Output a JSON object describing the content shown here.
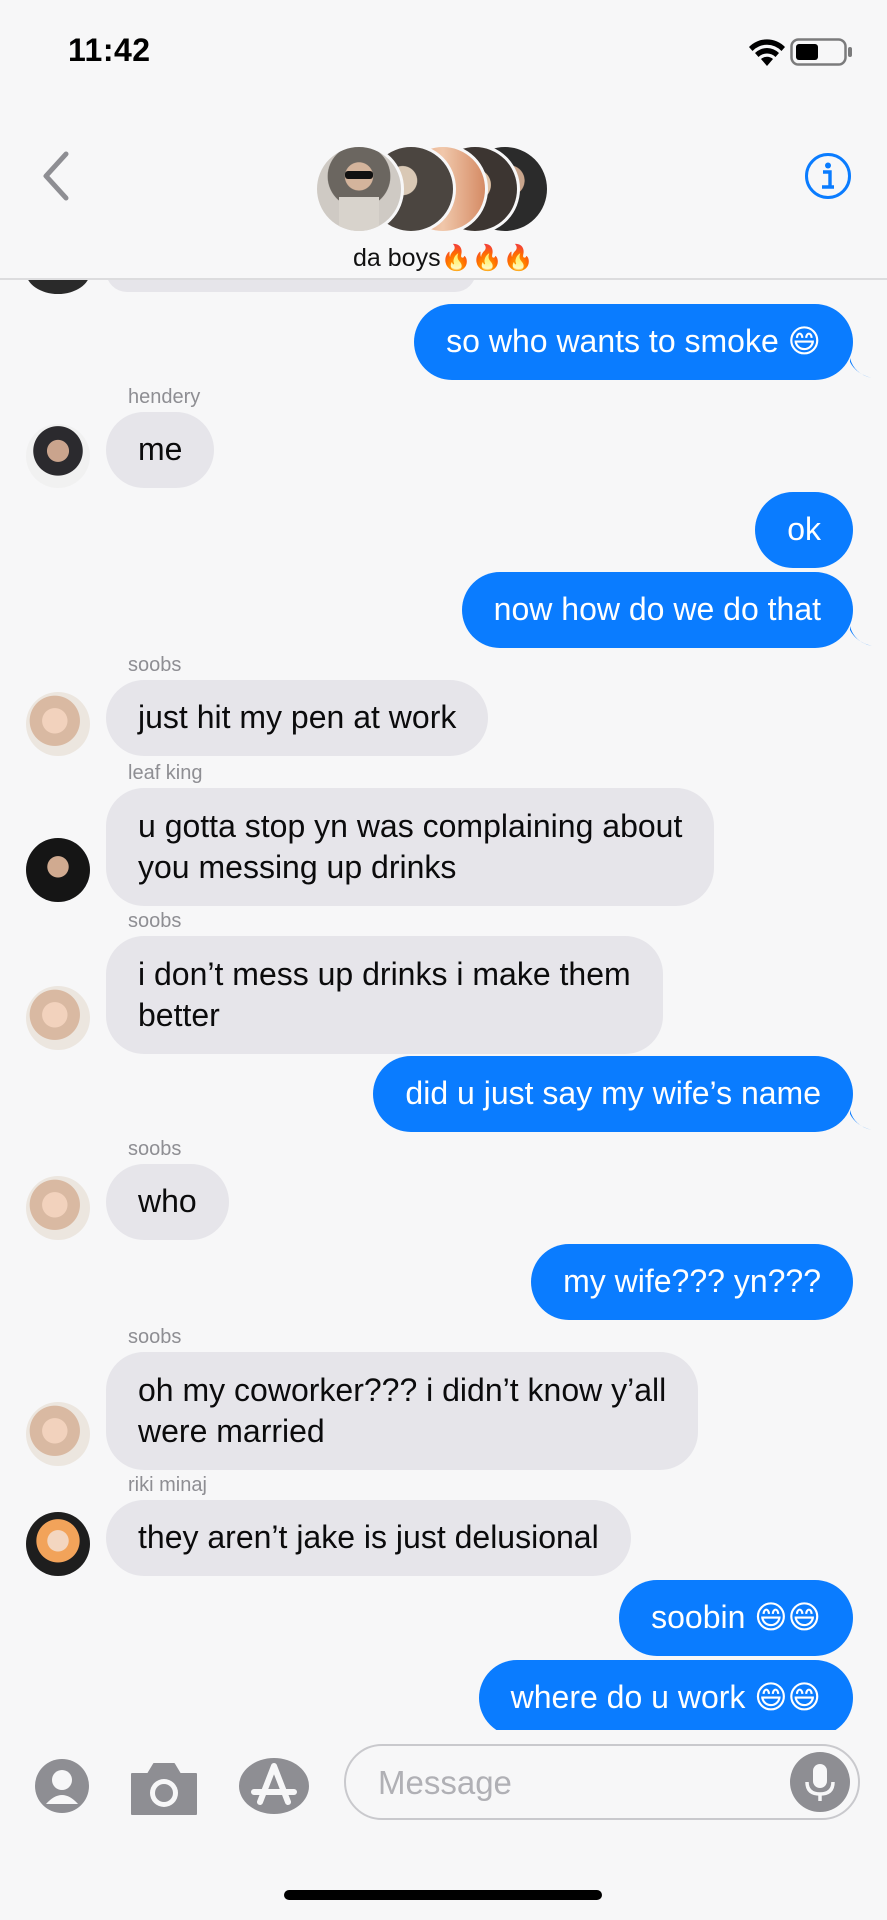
{
  "status": {
    "time": "11:42"
  },
  "header": {
    "group_name": "da boys🔥🔥🔥"
  },
  "messages": [
    {
      "text": "so who wants to smoke 😄"
    },
    {
      "sender": "hendery",
      "text": "me"
    },
    {
      "text": "ok"
    },
    {
      "text": "now how do we do that"
    },
    {
      "sender": "soobs",
      "text": "just hit my pen at work"
    },
    {
      "sender": "leaf king",
      "line1": "u gotta stop yn was complaining about",
      "line2": "you messing up drinks"
    },
    {
      "sender": "soobs",
      "line1": "i don’t mess up drinks i make them",
      "line2": "better"
    },
    {
      "text": "did u just say my wife’s name"
    },
    {
      "sender": "soobs",
      "text": "who"
    },
    {
      "text": "my wife??? yn???"
    },
    {
      "sender": "soobs",
      "line1": "oh my coworker??? i didn’t know y’all",
      "line2": "were married"
    },
    {
      "sender": "riki minaj",
      "text": "they aren’t jake is just delusional"
    },
    {
      "text": "soobin 😄😄"
    },
    {
      "text": "where do u work 😄😄"
    }
  ],
  "input": {
    "placeholder": "Message"
  },
  "colors": {
    "outgoing": "#0a7cff",
    "incoming": "#e6e5ea",
    "sender": "#8e8e93"
  },
  "icons": [
    "back-chevron-icon",
    "info-icon",
    "contact-icon",
    "camera-icon",
    "app-store-icon",
    "microphone-icon"
  ]
}
